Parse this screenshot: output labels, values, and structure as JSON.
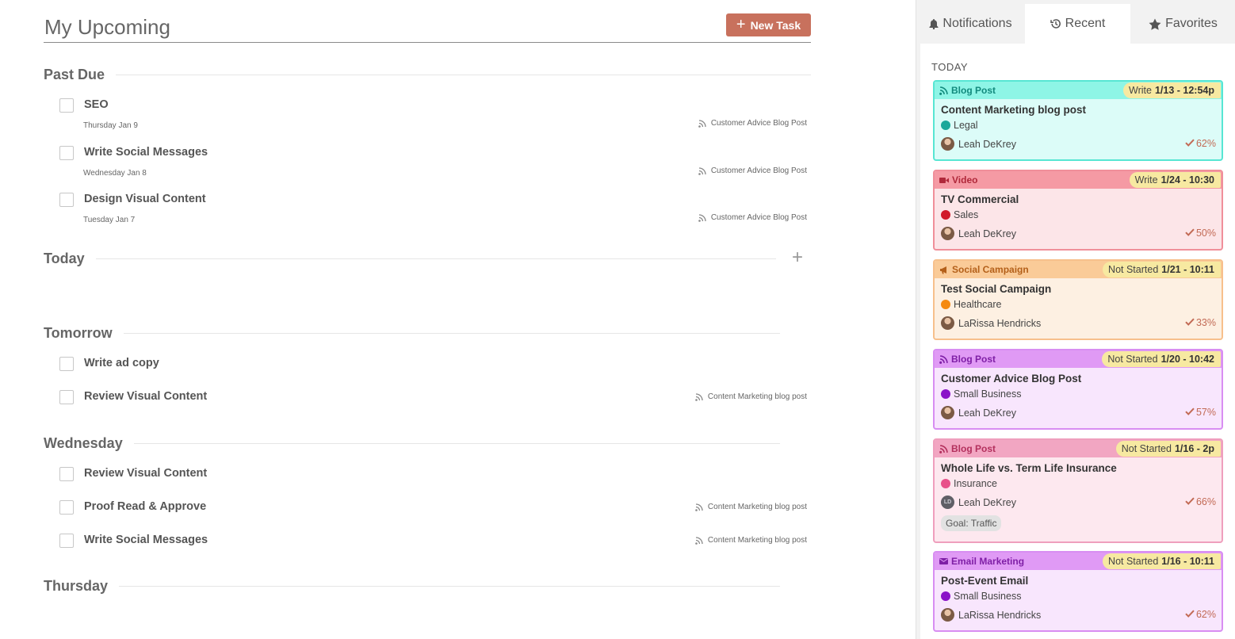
{
  "header": {
    "title": "My Upcoming",
    "new_task_label": "New Task"
  },
  "sections": {
    "past_due": {
      "title": "Past Due",
      "tasks": [
        {
          "name": "SEO",
          "date": "Thursday Jan 9",
          "link": "Customer Advice Blog Post"
        },
        {
          "name": "Write Social Messages",
          "date": "Wednesday Jan 8",
          "link": "Customer Advice Blog Post"
        },
        {
          "name": "Design Visual Content",
          "date": "Tuesday Jan 7",
          "link": "Customer Advice Blog Post"
        }
      ]
    },
    "today": {
      "title": "Today"
    },
    "tomorrow": {
      "title": "Tomorrow",
      "tasks": [
        {
          "name": "Write ad copy"
        },
        {
          "name": "Review Visual Content",
          "link": "Content Marketing blog post"
        }
      ]
    },
    "wednesday": {
      "title": "Wednesday",
      "tasks": [
        {
          "name": "Review Visual Content"
        },
        {
          "name": "Proof Read & Approve",
          "link": "Content Marketing blog post"
        },
        {
          "name": "Write Social Messages",
          "link": "Content Marketing blog post"
        }
      ]
    },
    "thursday": {
      "title": "Thursday"
    }
  },
  "panel": {
    "tabs": [
      {
        "label": "Notifications",
        "icon": "bell-icon"
      },
      {
        "label": "Recent",
        "icon": "history-icon",
        "active": true
      },
      {
        "label": "Favorites",
        "icon": "star-icon"
      }
    ],
    "group_label": "TODAY",
    "cards": [
      {
        "type": "Blog Post",
        "type_icon": "rss-icon",
        "status": "Write",
        "due": "1/13 - 12:54p",
        "title": "Content Marketing blog post",
        "category": "Legal",
        "category_color": "#1aa89a",
        "owner": "Leah DeKrey",
        "progress": "62%",
        "border": "#57e6d3",
        "head_bg": "#8ef5e6",
        "body_bg": "#dcfcf8",
        "type_color": "#128a7d"
      },
      {
        "type": "Video",
        "type_icon": "video-icon",
        "status": "Write",
        "due": "1/24 - 10:30",
        "title": "TV Commercial",
        "category": "Sales",
        "category_color": "#d11a2a",
        "owner": "Leah DeKrey",
        "progress": "50%",
        "border": "#f08f9a",
        "head_bg": "#f59aa4",
        "body_bg": "#fce5e8",
        "type_color": "#b0283a"
      },
      {
        "type": "Social Campaign",
        "type_icon": "megaphone-icon",
        "status": "Not Started",
        "due": "1/21 - 10:11",
        "title": "Test Social Campaign",
        "category": "Healthcare",
        "category_color": "#f5890e",
        "owner": "LaRissa Hendricks",
        "progress": "33%",
        "border": "#f7c08c",
        "head_bg": "#facb98",
        "body_bg": "#fdf0e2",
        "type_color": "#b4601a"
      },
      {
        "type": "Blog Post",
        "type_icon": "rss-icon",
        "status": "Not Started",
        "due": "1/20 - 10:42",
        "title": "Customer Advice Blog Post",
        "category": "Small Business",
        "category_color": "#8a12c8",
        "owner": "Leah DeKrey",
        "progress": "57%",
        "border": "#d88ef2",
        "head_bg": "#e09af5",
        "body_bg": "#f8e6fd",
        "type_color": "#7f1fa6"
      },
      {
        "type": "Blog Post",
        "type_icon": "rss-icon",
        "status": "Not Started",
        "due": "1/16 - 2p",
        "title": "Whole Life vs. Term Life Insurance",
        "category": "Insurance",
        "category_color": "#e8528a",
        "owner": "Leah DeKrey",
        "owner_initials": "LD",
        "progress": "66%",
        "goal": "Goal: Traffic",
        "border": "#ef9fbd",
        "head_bg": "#f2a6c2",
        "body_bg": "#fde8ef",
        "type_color": "#b3305d"
      },
      {
        "type": "Email Marketing",
        "type_icon": "mail-icon",
        "status": "Not Started",
        "due": "1/16 - 10:11",
        "title": "Post-Event Email",
        "category": "Small Business",
        "category_color": "#8a12c8",
        "owner": "LaRissa Hendricks",
        "progress": "62%",
        "border": "#d88ef2",
        "head_bg": "#e09af5",
        "body_bg": "#f8e6fd",
        "type_color": "#7f1fa6"
      }
    ]
  },
  "colors": {
    "accent": "#c8715d",
    "progress": "#c26a55",
    "status_pill": "#f7e9a1"
  }
}
